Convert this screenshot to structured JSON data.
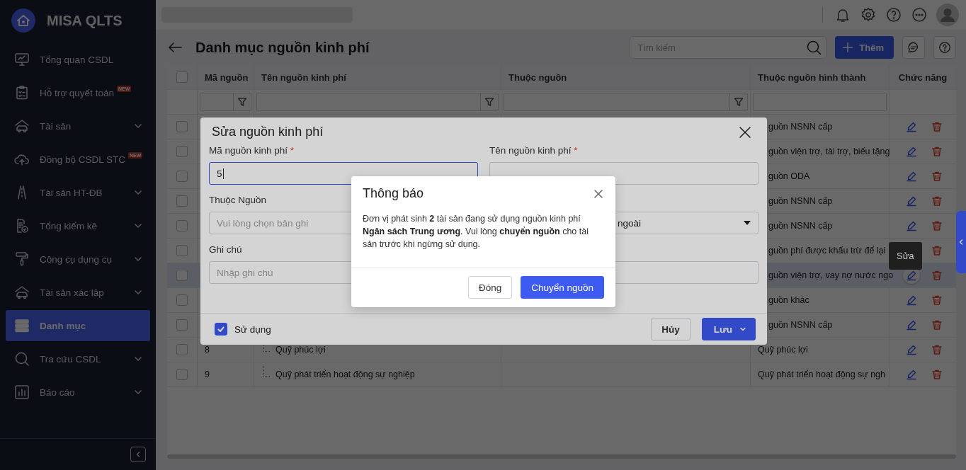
{
  "sidebar": {
    "app_name": "MISA QLTS",
    "items": [
      {
        "label": "Tổng quan CSDL",
        "expandable": false,
        "selected": false
      },
      {
        "label": "Hỗ trợ quyết toán",
        "badge": "NEW",
        "expandable": false,
        "selected": false
      },
      {
        "label": "Tài sản",
        "expandable": true,
        "selected": false
      },
      {
        "label": "Đồng bộ CSDL STC",
        "badge": "NEW",
        "expandable": false,
        "selected": false
      },
      {
        "label": "Tài sản HT-ĐB",
        "expandable": true,
        "selected": false
      },
      {
        "label": "Tổng kiểm kê",
        "expandable": true,
        "selected": false
      },
      {
        "label": "Công cụ dụng cụ",
        "expandable": true,
        "selected": false
      },
      {
        "label": "Tài sản xác lập",
        "expandable": true,
        "selected": false
      },
      {
        "label": "Danh mục",
        "expandable": false,
        "selected": true
      },
      {
        "label": "Tra cứu CSDL",
        "expandable": true,
        "selected": false
      },
      {
        "label": "Báo cáo",
        "expandable": true,
        "selected": false
      }
    ]
  },
  "page": {
    "title": "Danh mục nguồn kinh phí",
    "search": {
      "placeholder": "Tìm kiếm"
    },
    "add_button": "Thêm"
  },
  "table": {
    "header_checked": false,
    "columns": [
      "Mã nguồn",
      "Tên nguồn kinh phí",
      "Thuộc nguồn",
      "Thuộc nguồn hình thành",
      "Chức năng"
    ],
    "rows": [
      {
        "checked": false,
        "selected": false,
        "formation": "guồn NSNN cấp"
      },
      {
        "checked": false,
        "selected": false,
        "formation": "guồn viện trợ, tài trợ, biếu tặng"
      },
      {
        "checked": false,
        "selected": false,
        "formation": "guồn ODA"
      },
      {
        "checked": false,
        "selected": false,
        "formation": "guồn NSNN cấp"
      },
      {
        "checked": false,
        "selected": false,
        "formation": "guồn NSNN cấp"
      },
      {
        "checked": false,
        "selected": false,
        "formation": "guồn phí được khấu trừ để lại"
      },
      {
        "checked": false,
        "selected": true,
        "formation": "guồn viện trợ, vay nợ nước ngo"
      },
      {
        "checked": false,
        "selected": false,
        "formation": "guồn khác"
      },
      {
        "checked": false,
        "selected": false,
        "formation": "guồn NSNN cấp"
      },
      {
        "checked": false,
        "selected": false,
        "code": "8",
        "name": "Quỹ phúc lợi",
        "formation": "Quỹ phúc lợi"
      },
      {
        "checked": false,
        "selected": false,
        "code": "9",
        "name": "Quỹ phát triển hoạt động sự nghiệp",
        "formation": "Quỹ phát triển hoạt động sự ngh"
      }
    ]
  },
  "tooltip": "Sửa",
  "edit_dialog": {
    "title": "Sửa nguồn kinh phí",
    "fields": [
      {
        "kind": "text",
        "label": "Mã nguồn kinh phí",
        "required_mark": "*",
        "value": "5",
        "focused": true
      },
      {
        "kind": "text",
        "label": "Tên nguồn kinh phí",
        "required_mark": "*",
        "focused": false
      },
      {
        "kind": "picker",
        "label": "Thuộc Nguồn",
        "placeholder": "Vui lòng chọn bản ghi",
        "focused": false
      },
      {
        "kind": "dropdown",
        "value": "ngoài",
        "focused": false
      },
      {
        "kind": "textarea",
        "label": "Ghi chú",
        "placeholder": "Nhập ghi chú",
        "focused": false
      }
    ],
    "use": {
      "label": "Sử dụng",
      "checked": true
    },
    "cancel_button": "Hủy",
    "save_button": "Lưu"
  },
  "notice": {
    "title": "Thông báo",
    "message": "Đơn vị phát sinh **2** tài sản đang sử dụng nguồn kinh phí **Ngân sách Trung ương**. Vui lòng **chuyển nguồn** cho tài sản trước khi ngừng sử dụng.",
    "buttons": [
      {
        "label": "Đóng",
        "primary": false
      },
      {
        "label": "Chuyển nguồn",
        "primary": true
      }
    ]
  }
}
